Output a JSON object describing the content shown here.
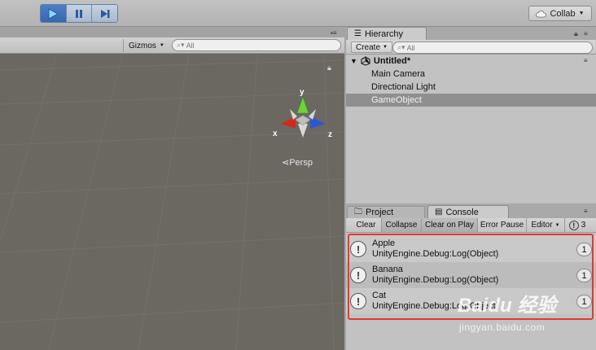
{
  "toolbar": {
    "play_icon": "play-icon",
    "pause_icon": "pause-icon",
    "step_icon": "step-icon",
    "collab_label": "Collab",
    "collab_icon": "cloud-icon"
  },
  "scene": {
    "gizmos_label": "Gizmos",
    "search_placeholder": "All",
    "persp_label": "Persp",
    "gizmo_axes": {
      "x": "x",
      "y": "y",
      "z": "z"
    }
  },
  "hierarchy": {
    "tab_label": "Hierarchy",
    "create_label": "Create",
    "search_placeholder": "All",
    "scene_name": "Untitled*",
    "items": [
      {
        "label": "Main Camera"
      },
      {
        "label": "Directional Light"
      },
      {
        "label": "GameObject"
      }
    ]
  },
  "console": {
    "tabs": [
      {
        "label": "Project"
      },
      {
        "label": "Console"
      }
    ],
    "toolbar": {
      "clear": "Clear",
      "collapse": "Collapse",
      "clear_on_play": "Clear on Play",
      "error_pause": "Error Pause",
      "editor": "Editor",
      "log_count": "3"
    },
    "logs": [
      {
        "message": "Apple",
        "source": "UnityEngine.Debug:Log(Object)",
        "count": "1"
      },
      {
        "message": "Banana",
        "source": "UnityEngine.Debug:Log(Object)",
        "count": "1"
      },
      {
        "message": "Cat",
        "source": "UnityEngine.Debug:Log(Object)",
        "count": "1"
      }
    ]
  },
  "watermark": {
    "logo": "Baidu 经验",
    "url": "jingyan.baidu.com"
  },
  "colors": {
    "highlight": "#e53935",
    "play_active": "#3867ad",
    "selection": "#8f8f8f"
  }
}
